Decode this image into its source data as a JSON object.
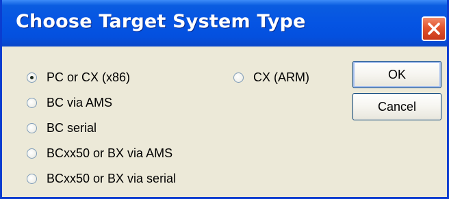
{
  "window": {
    "title": "Choose Target System Type"
  },
  "options": [
    {
      "label": "PC or CX (x86)",
      "checked": true
    },
    {
      "label": "BC via AMS",
      "checked": false
    },
    {
      "label": "BC serial",
      "checked": false
    },
    {
      "label": "BCxx50 or BX via AMS",
      "checked": false
    },
    {
      "label": "BCxx50 or BX via serial",
      "checked": false
    },
    {
      "label": "CX (ARM)",
      "checked": false
    }
  ],
  "buttons": {
    "ok_label": "OK",
    "cancel_label": "Cancel"
  },
  "colors": {
    "titlebar": "#0554e3",
    "dialog_bg": "#ece9d8",
    "close_button": "#e2542e"
  },
  "icons": {
    "close": "close-icon"
  }
}
